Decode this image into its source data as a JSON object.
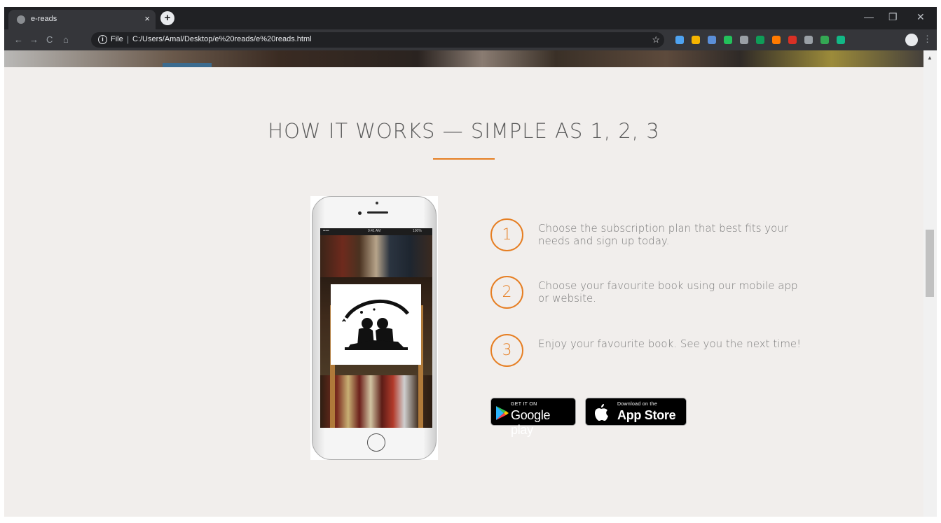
{
  "browser": {
    "tab_title": "e-reads",
    "tab_close": "×",
    "new_tab": "+",
    "window_controls": {
      "minimize": "—",
      "restore": "❐",
      "close": "✕"
    },
    "nav": {
      "back": "←",
      "forward": "→",
      "reload": "C",
      "home": "⌂"
    },
    "address": {
      "info": "i",
      "scheme": "File",
      "separator": "|",
      "url": "C:/Users/Amal/Desktop/e%20reads/e%20reads.html",
      "bookmark": "☆"
    },
    "menu": "⋮",
    "extension_colors": [
      "#4ea3f1",
      "#f4b400",
      "#5b8fd8",
      "#23c15b",
      "#9aa0a6",
      "#0f9d58",
      "#ff7a00",
      "#d93025",
      "#9aa0a6",
      "#34a853",
      "#12b886"
    ],
    "scroll_up": "▲"
  },
  "section": {
    "heading": "HOW IT WORKS — SIMPLE AS 1, 2, 3",
    "accent_color": "#e67e22",
    "phone": {
      "status_carrier": "•••••",
      "status_time": "9:41 AM",
      "status_battery": "100%"
    },
    "steps": [
      {
        "number": "1",
        "text": "Choose the subscription plan that best fits your needs and sign up today."
      },
      {
        "number": "2",
        "text": "Choose your favourite book using our mobile app or website."
      },
      {
        "number": "3",
        "text": "Enjoy your favourite book. See you the next time!"
      }
    ],
    "badges": {
      "google": {
        "small": "GET IT ON",
        "big": "Google play"
      },
      "apple": {
        "small": "Download on the",
        "big": "App Store"
      }
    }
  }
}
